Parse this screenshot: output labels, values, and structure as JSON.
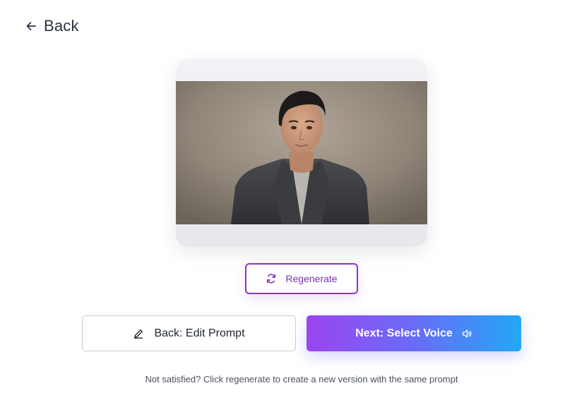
{
  "header": {
    "back_label": "Back",
    "back_icon": "arrow-left-icon"
  },
  "preview": {
    "subject": "portrait-photo"
  },
  "actions": {
    "regenerate_label": "Regenerate",
    "regenerate_icon": "refresh-icon",
    "edit_prompt_label": "Back: Edit Prompt",
    "edit_prompt_icon": "pencil-icon",
    "next_label": "Next: Select Voice",
    "next_icon": "speaker-icon"
  },
  "hint_text": "Not satisfied? Click regenerate to create a new version with the same prompt",
  "colors": {
    "accent_purple": "#8a35c4",
    "gradient_start": "#9b45f0",
    "gradient_end": "#22a7f7",
    "text_dark": "#2b3342"
  }
}
